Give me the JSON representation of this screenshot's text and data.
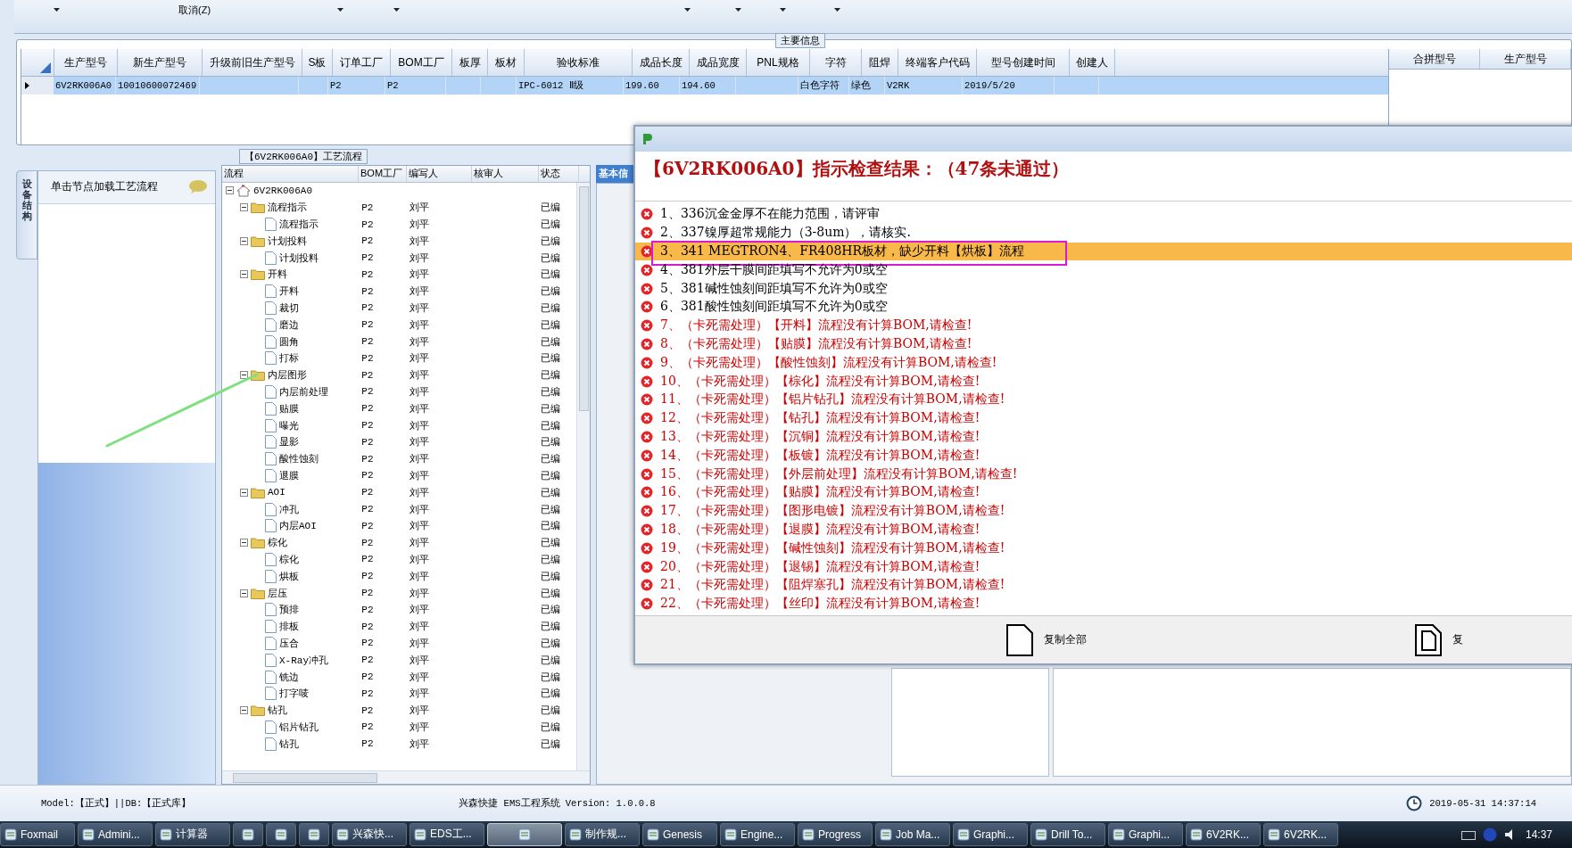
{
  "toolbar": {
    "cancel_label": "取消(Z)"
  },
  "main_info": {
    "title": "主要信息",
    "table": {
      "columns": [
        "生产型号",
        "新生产型号",
        "升级前旧生产型号",
        "S板",
        "订单工厂",
        "BOM工厂",
        "板厚",
        "板材",
        "验收标准",
        "成品长度",
        "成品宽度",
        "PNL规格",
        "字符",
        "阻焊",
        "终端客户代码",
        "型号创建时间",
        "创建人"
      ],
      "rows": [
        {
          "selected": true,
          "cells": [
            "6V2RK006A0",
            "10010600072469",
            "",
            "",
            "P2",
            "P2",
            "",
            "",
            "IPC-6012 Ⅱ级",
            "199.60",
            "194.60",
            "",
            "白色字符",
            "绿色",
            "V2RK",
            "2019/5/20",
            ""
          ]
        }
      ]
    },
    "merge_table": {
      "columns": [
        "合拼型号",
        "生产型号"
      ]
    }
  },
  "left_panel": {
    "tab": "设备结构",
    "hint": "单击节点加载工艺流程"
  },
  "process": {
    "title": "【6V2RK006A0】工艺流程",
    "columns": [
      "流程",
      "BOM工厂",
      "编写人",
      "核审人",
      "状态"
    ],
    "tree": [
      {
        "label": "6V2RK006A0",
        "expanded": true,
        "children": [
          {
            "label": "流程指示",
            "bom": "P2",
            "writer": "刘平",
            "status": "已编",
            "expanded": true,
            "children": [
              {
                "label": "流程指示",
                "bom": "P2",
                "writer": "刘平",
                "status": "已编"
              }
            ]
          },
          {
            "label": "计划投料",
            "bom": "P2",
            "writer": "刘平",
            "status": "已编",
            "expanded": true,
            "children": [
              {
                "label": "计划投料",
                "bom": "P2",
                "writer": "刘平",
                "status": "已编"
              }
            ]
          },
          {
            "label": "开料",
            "bom": "P2",
            "writer": "刘平",
            "status": "已编",
            "expanded": true,
            "children": [
              {
                "label": "开料",
                "bom": "P2",
                "writer": "刘平",
                "status": "已编"
              },
              {
                "label": "裁切",
                "bom": "P2",
                "writer": "刘平",
                "status": "已编"
              },
              {
                "label": "磨边",
                "bom": "P2",
                "writer": "刘平",
                "status": "已编"
              },
              {
                "label": "圆角",
                "bom": "P2",
                "writer": "刘平",
                "status": "已编"
              },
              {
                "label": "打标",
                "bom": "P2",
                "writer": "刘平",
                "status": "已编"
              }
            ]
          },
          {
            "label": "内层图形",
            "bom": "P2",
            "writer": "刘平",
            "status": "已编",
            "expanded": true,
            "children": [
              {
                "label": "内层前处理",
                "bom": "P2",
                "writer": "刘平",
                "status": "已编"
              },
              {
                "label": "贴膜",
                "bom": "P2",
                "writer": "刘平",
                "status": "已编"
              },
              {
                "label": "曝光",
                "bom": "P2",
                "writer": "刘平",
                "status": "已编"
              },
              {
                "label": "显影",
                "bom": "P2",
                "writer": "刘平",
                "status": "已编"
              },
              {
                "label": "酸性蚀刻",
                "bom": "P2",
                "writer": "刘平",
                "status": "已编"
              },
              {
                "label": "退膜",
                "bom": "P2",
                "writer": "刘平",
                "status": "已编"
              }
            ]
          },
          {
            "label": "AOI",
            "bom": "P2",
            "writer": "刘平",
            "status": "已编",
            "expanded": true,
            "children": [
              {
                "label": "冲孔",
                "bom": "P2",
                "writer": "刘平",
                "status": "已编"
              },
              {
                "label": "内层AOI",
                "bom": "P2",
                "writer": "刘平",
                "status": "已编"
              }
            ]
          },
          {
            "label": "棕化",
            "bom": "P2",
            "writer": "刘平",
            "status": "已编",
            "expanded": true,
            "children": [
              {
                "label": "棕化",
                "bom": "P2",
                "writer": "刘平",
                "status": "已编"
              },
              {
                "label": "烘板",
                "bom": "P2",
                "writer": "刘平",
                "status": "已编"
              }
            ]
          },
          {
            "label": "层压",
            "bom": "P2",
            "writer": "刘平",
            "status": "已编",
            "expanded": true,
            "children": [
              {
                "label": "预排",
                "bom": "P2",
                "writer": "刘平",
                "status": "已编"
              },
              {
                "label": "排板",
                "bom": "P2",
                "writer": "刘平",
                "status": "已编"
              },
              {
                "label": "压合",
                "bom": "P2",
                "writer": "刘平",
                "status": "已编"
              },
              {
                "label": "X-Ray冲孔",
                "bom": "P2",
                "writer": "刘平",
                "status": "已编"
              },
              {
                "label": "铣边",
                "bom": "P2",
                "writer": "刘平",
                "status": "已编"
              },
              {
                "label": "打字唛",
                "bom": "P2",
                "writer": "刘平",
                "status": "已编"
              }
            ]
          },
          {
            "label": "钻孔",
            "bom": "P2",
            "writer": "刘平",
            "status": "已编",
            "expanded": true,
            "children": [
              {
                "label": "铝片钻孔",
                "bom": "P2",
                "writer": "刘平",
                "status": "已编"
              },
              {
                "label": "钻孔",
                "bom": "P2",
                "writer": "刘平",
                "status": "已编"
              }
            ]
          }
        ]
      }
    ]
  },
  "detail_panel": {
    "tab": "基本信"
  },
  "dialog": {
    "heading": "【6V2RK006A0】指示检查结果：（47条未通过）",
    "items": [
      {
        "kind": "notice",
        "text": "1、336沉金金厚不在能力范围，请评审",
        "selected": false
      },
      {
        "kind": "notice",
        "text": "2、337镍厚超常规能力（3-8um），请核实.",
        "selected": false
      },
      {
        "kind": "notice",
        "text": "3、341  MEGTRON4、FR408HR板材，缺少开料【烘板】流程",
        "selected": true
      },
      {
        "kind": "notice",
        "text": "4、381外层干膜间距填写不允许为0或空",
        "selected": false
      },
      {
        "kind": "notice",
        "text": "5、381碱性蚀刻间距填写不允许为0或空",
        "selected": false
      },
      {
        "kind": "notice",
        "text": "6、381酸性蚀刻间距填写不允许为0或空",
        "selected": false
      },
      {
        "kind": "blocking",
        "text": "7、（卡死需处理）【开料】流程没有计算BOM,请检查!",
        "selected": false
      },
      {
        "kind": "blocking",
        "text": "8、（卡死需处理）【贴膜】流程没有计算BOM,请检查!",
        "selected": false
      },
      {
        "kind": "blocking",
        "text": "9、（卡死需处理）【酸性蚀刻】流程没有计算BOM,请检查!",
        "selected": false
      },
      {
        "kind": "blocking",
        "text": "10、（卡死需处理）【棕化】流程没有计算BOM,请检查!",
        "selected": false
      },
      {
        "kind": "blocking",
        "text": "11、（卡死需处理）【铝片钻孔】流程没有计算BOM,请检查!",
        "selected": false
      },
      {
        "kind": "blocking",
        "text": "12、（卡死需处理）【钻孔】流程没有计算BOM,请检查!",
        "selected": false
      },
      {
        "kind": "blocking",
        "text": "13、（卡死需处理）【沉铜】流程没有计算BOM,请检查!",
        "selected": false
      },
      {
        "kind": "blocking",
        "text": "14、（卡死需处理）【板镀】流程没有计算BOM,请检查!",
        "selected": false
      },
      {
        "kind": "blocking",
        "text": "15、（卡死需处理）【外层前处理】流程没有计算BOM,请检查!",
        "selected": false
      },
      {
        "kind": "blocking",
        "text": "16、（卡死需处理）【贴膜】流程没有计算BOM,请检查!",
        "selected": false
      },
      {
        "kind": "blocking",
        "text": "17、（卡死需处理）【图形电镀】流程没有计算BOM,请检查!",
        "selected": false
      },
      {
        "kind": "blocking",
        "text": "18、（卡死需处理）【退膜】流程没有计算BOM,请检查!",
        "selected": false
      },
      {
        "kind": "blocking",
        "text": "19、（卡死需处理）【碱性蚀刻】流程没有计算BOM,请检查!",
        "selected": false
      },
      {
        "kind": "blocking",
        "text": "20、（卡死需处理）【退锡】流程没有计算BOM,请检查!",
        "selected": false
      },
      {
        "kind": "blocking",
        "text": "21、（卡死需处理）【阻焊塞孔】流程没有计算BOM,请检查!",
        "selected": false
      },
      {
        "kind": "blocking",
        "text": "22、（卡死需处理）【丝印】流程没有计算BOM,请检查!",
        "selected": false
      }
    ],
    "buttons": [
      {
        "label": "复制全部"
      },
      {
        "label": "复"
      }
    ]
  },
  "status_bar": {
    "left": "Model:【正式】||DB:【正式库】",
    "center": "兴森快捷 EMS工程系统 Version: 1.0.0.8",
    "datetime": "2019-05-31 14:37:14"
  },
  "taskbar": {
    "items": [
      {
        "kind": "app",
        "label": "Foxmail",
        "selected": false
      },
      {
        "kind": "app",
        "label": "Admini...",
        "selected": false
      },
      {
        "kind": "app",
        "label": "计算器",
        "selected": false
      },
      {
        "kind": "icon",
        "selected": false
      },
      {
        "kind": "icon",
        "selected": false
      },
      {
        "kind": "icon",
        "selected": false
      },
      {
        "kind": "app",
        "label": "兴森快...",
        "selected": false
      },
      {
        "kind": "app",
        "label": "EDS工...",
        "selected": false
      },
      {
        "kind": "icon",
        "selected": true
      },
      {
        "kind": "app",
        "label": "制作规...",
        "selected": false
      },
      {
        "kind": "app",
        "label": "Genesis",
        "selected": false
      },
      {
        "kind": "app",
        "label": "Engine...",
        "selected": false
      },
      {
        "kind": "app",
        "label": "Progress",
        "selected": false
      },
      {
        "kind": "app",
        "label": "Job Ma...",
        "selected": false
      },
      {
        "kind": "app",
        "label": "Graphi...",
        "selected": false
      },
      {
        "kind": "app",
        "label": "Drill To...",
        "selected": false
      },
      {
        "kind": "app",
        "label": "Graphi...",
        "selected": false
      },
      {
        "kind": "app",
        "label": "6V2RK...",
        "selected": false
      },
      {
        "kind": "app",
        "label": "6V2RK...",
        "selected": false
      }
    ],
    "clock": "14:37"
  }
}
